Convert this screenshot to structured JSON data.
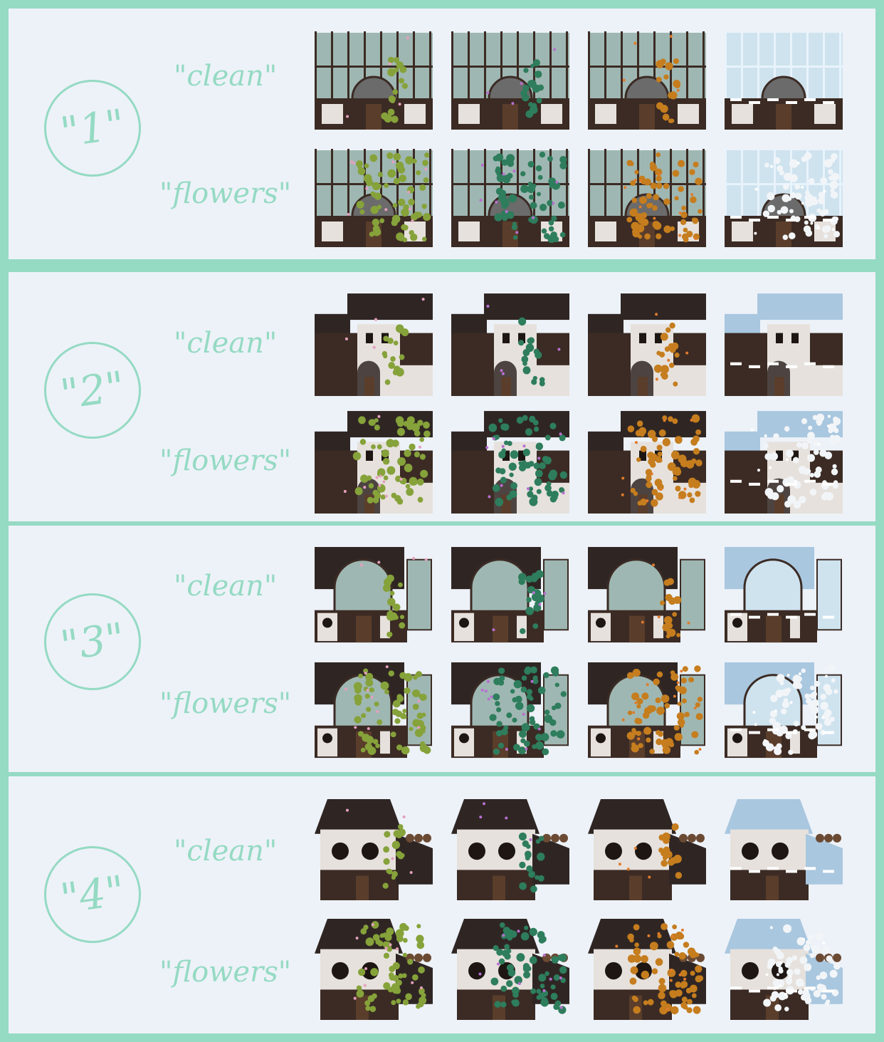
{
  "palette": {
    "frame": "#95dac3",
    "panel": "#edf2f8",
    "ink": "#95dac3",
    "wall_dark": "#3b2b24",
    "roof_dark": "#2f2624",
    "wall_light": "#e6e1dc",
    "glass": "#9fb7b2",
    "snow_roof": "#a9c7df"
  },
  "labels": {
    "clean": "\"clean\"",
    "flowers": "\"flowers\""
  },
  "seasons": [
    "spring",
    "summer",
    "fall",
    "winter"
  ],
  "season_colors": {
    "spring": {
      "plant": "#86a23a",
      "accent": "#e5a0be"
    },
    "summer": {
      "plant": "#2e7d5d",
      "accent": "#b86fd0"
    },
    "fall": {
      "plant": "#c57d1e",
      "accent": "#e07b2c"
    },
    "winter": {
      "plant": "#f2f5f8",
      "accent": "#ffffff"
    }
  },
  "groups": [
    {
      "number": "\"1\"",
      "style": "greenhouse"
    },
    {
      "number": "\"2\"",
      "style": "cottage"
    },
    {
      "number": "\"3\"",
      "style": "conservatory"
    },
    {
      "number": "\"4\"",
      "style": "barn"
    }
  ]
}
